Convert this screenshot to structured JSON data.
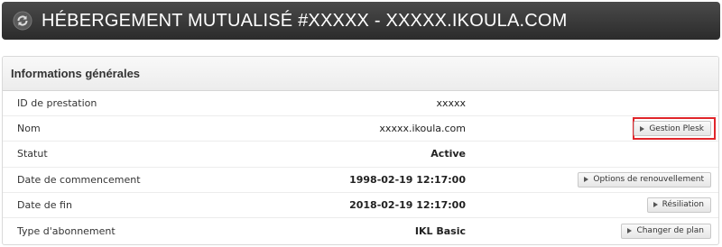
{
  "header": {
    "title": "HÉBERGEMENT MUTUALISÉ #XXXXX - XXXXX.IKOULA.COM",
    "icon": "refresh-icon"
  },
  "panel": {
    "title": "Informations générales",
    "rows": [
      {
        "label": "ID de prestation",
        "value": "xxxxx",
        "action": ""
      },
      {
        "label": "Nom",
        "value": "xxxxx.ikoula.com",
        "action": "Gestion Plesk"
      },
      {
        "label": "Statut",
        "value": "Active",
        "action": ""
      },
      {
        "label": "Date de commencement",
        "value": "1998-02-19 12:17:00",
        "action": "Options de renouvellement"
      },
      {
        "label": "Date de fin",
        "value": "2018-02-19 12:17:00",
        "action": "Résiliation"
      },
      {
        "label": "Type d'abonnement",
        "value": "IKL Basic",
        "action": "Changer de plan"
      }
    ]
  },
  "colors": {
    "header_bg": "#333333",
    "highlight": "#e0262b"
  }
}
